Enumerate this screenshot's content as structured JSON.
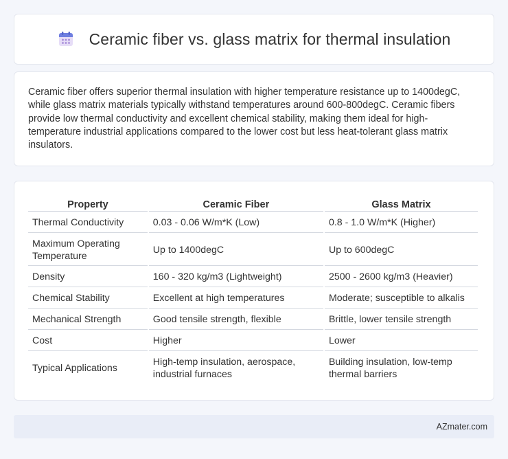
{
  "header": {
    "title": "Ceramic fiber vs. glass matrix for thermal insulation",
    "icon": "calendar-icon"
  },
  "summary": {
    "text": "Ceramic fiber offers superior thermal insulation with higher temperature resistance up to 1400degC, while glass matrix materials typically withstand temperatures around 600-800degC. Ceramic fibers provide low thermal conductivity and excellent chemical stability, making them ideal for high-temperature industrial applications compared to the lower cost but less heat-tolerant glass matrix insulators."
  },
  "table": {
    "headers": [
      "Property",
      "Ceramic Fiber",
      "Glass Matrix"
    ],
    "rows": [
      [
        "Thermal Conductivity",
        "0.03 - 0.06 W/m*K (Low)",
        "0.8 - 1.0 W/m*K (Higher)"
      ],
      [
        "Maximum Operating Temperature",
        "Up to 1400degC",
        "Up to 600degC"
      ],
      [
        "Density",
        "160 - 320 kg/m3 (Lightweight)",
        "2500 - 2600 kg/m3 (Heavier)"
      ],
      [
        "Chemical Stability",
        "Excellent at high temperatures",
        "Moderate; susceptible to alkalis"
      ],
      [
        "Mechanical Strength",
        "Good tensile strength, flexible",
        "Brittle, lower tensile strength"
      ],
      [
        "Cost",
        "Higher",
        "Lower"
      ],
      [
        "Typical Applications",
        "High-temp insulation, aerospace, industrial furnaces",
        "Building insulation, low-temp thermal barriers"
      ]
    ]
  },
  "footer": {
    "site": "AZmater.com"
  }
}
